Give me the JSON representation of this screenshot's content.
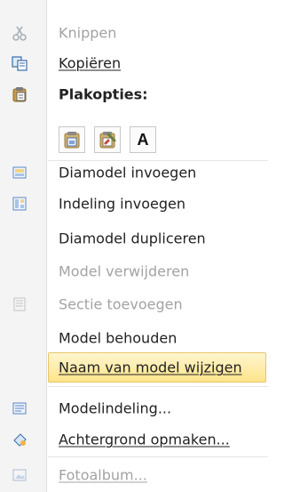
{
  "menu": {
    "items": [
      {
        "id": "knippen",
        "label": "Knippen",
        "icon": "scissors-icon",
        "state": "disabled"
      },
      {
        "id": "kopieren",
        "label": "Kopiëren",
        "icon": "copy-icon",
        "state": "enabled"
      },
      {
        "id": "plakopties",
        "label": "Plakopties:",
        "icon": "clipboard-icon",
        "state": "section-header"
      },
      {
        "id": "diamodel-invoegen",
        "label": "Diamodel invoegen",
        "icon": "insert-slide-master-icon",
        "state": "enabled"
      },
      {
        "id": "indeling-invoegen",
        "label": "Indeling invoegen",
        "icon": "insert-layout-icon",
        "state": "enabled"
      },
      {
        "id": "diamodel-dupliceren",
        "label": "Diamodel dupliceren",
        "icon": "",
        "state": "enabled"
      },
      {
        "id": "model-verwijderen",
        "label": "Model verwijderen",
        "icon": "",
        "state": "disabled"
      },
      {
        "id": "sectie-toevoegen",
        "label": "Sectie toevoegen",
        "icon": "add-section-icon",
        "state": "disabled"
      },
      {
        "id": "model-behouden",
        "label": "Model behouden",
        "icon": "",
        "state": "enabled"
      },
      {
        "id": "naam-wijzigen",
        "label": "Naam van model wijzigen",
        "icon": "",
        "state": "highlighted"
      },
      {
        "id": "modelindeling",
        "label": "Modelindeling...",
        "icon": "master-layout-icon",
        "state": "enabled"
      },
      {
        "id": "achtergrond-opmaken",
        "label": "Achtergrond opmaken...",
        "icon": "format-background-icon",
        "state": "enabled"
      },
      {
        "id": "fotoalbum",
        "label": "Fotoalbum...",
        "icon": "photo-album-icon",
        "state": "disabled"
      }
    ],
    "paste_options": [
      {
        "name": "paste-use-destination-theme-icon",
        "glyph": ""
      },
      {
        "name": "paste-keep-source-formatting-icon",
        "glyph": ""
      },
      {
        "name": "paste-keep-text-only-icon",
        "glyph": "A"
      }
    ]
  },
  "colors": {
    "highlight_border": "#e9c46a",
    "highlight_fill": "#ffe48a",
    "disabled_text": "#a3a3a3"
  }
}
